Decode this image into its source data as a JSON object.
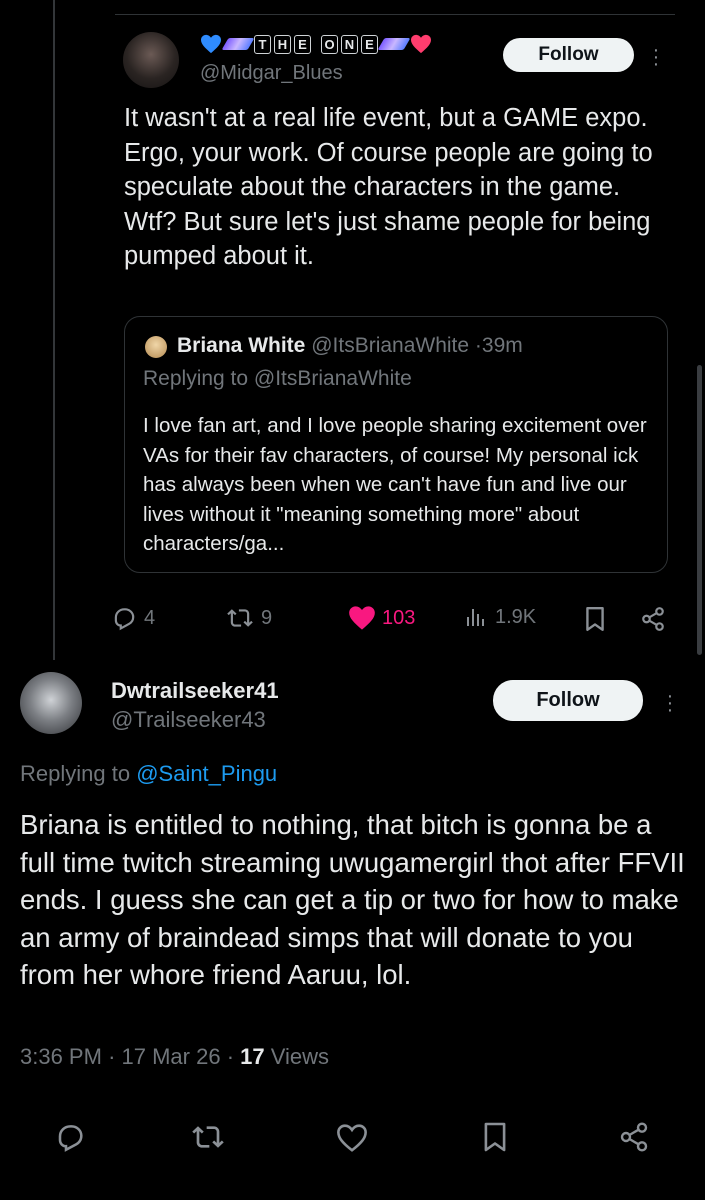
{
  "quoted_tweet_author": {
    "badge_letters": [
      "T",
      "H",
      "E",
      "O",
      "N",
      "E"
    ],
    "handle": "@Midgar_Blues",
    "follow_label": "Follow"
  },
  "tweet1": {
    "paragraphs": [
      "It wasn't at a real life event, but a GAME expo. Ergo, your work. Of course people are going to speculate about the characters in the game.",
      "Wtf? But sure let's just shame people for being pumped about it."
    ],
    "quote": {
      "name": "Briana White",
      "handle": "@ItsBrianaWhite",
      "separator": "·",
      "time": "39m",
      "replying_prefix": "Replying to ",
      "replying_handle": "@ItsBrianaWhite",
      "text": "I love fan art, and I love people sharing excitement over VAs for their fav characters, of course! My personal ick has always been when we can't have fun and live our lives without it \"meaning something more\" about characters/ga..."
    },
    "actions": {
      "replies": "4",
      "reposts": "9",
      "likes": "103",
      "views": "1.9K"
    }
  },
  "tweet2": {
    "display_name": "Dwtrailseeker41",
    "handle": "@Trailseeker43",
    "follow_label": "Follow",
    "replying_prefix": "Replying to ",
    "replying_handle": "@Saint_Pingu",
    "body": "Briana is entitled to nothing, that bitch is gonna be a full time twitch streaming uwugamergirl thot after FFVII ends. I guess she can get a tip or two for how to make an army of braindead simps that will donate to you from her whore friend Aaruu, lol.",
    "time": "3:36 PM",
    "date": "17 Mar 26",
    "separator": "·",
    "views_count": "17",
    "views_label": "Views"
  },
  "colors": {
    "background": "#000000",
    "text": "#e7e9ea",
    "secondary_text": "#71767b",
    "link": "#1d9bf0",
    "like": "#f91880",
    "follow_bg": "#eff3f4"
  },
  "icons": [
    "blue-heart-icon",
    "sparkle-icon",
    "pink-heart-icon",
    "reply-icon",
    "repost-icon",
    "like-icon",
    "views-icon",
    "bookmark-icon",
    "share-icon",
    "more-icon"
  ]
}
